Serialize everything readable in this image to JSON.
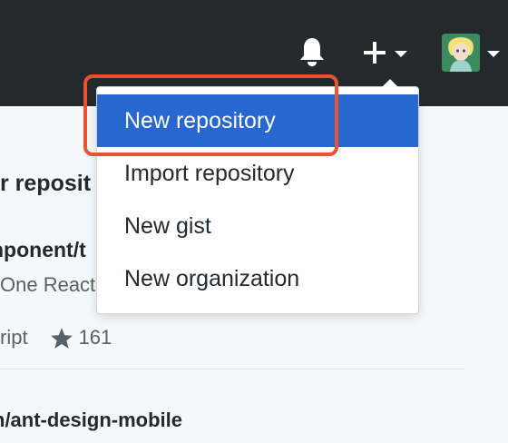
{
  "header": {
    "notification_icon": "bell-icon",
    "create_icon": "plus-icon",
    "avatar_icon": "user-avatar"
  },
  "content": {
    "heading_fragment": "r reposit",
    "repos": [
      {
        "name_fragment": "nponent/t",
        "desc_fragment": "One React",
        "lang_fragment": "ript",
        "stars": "161"
      },
      {
        "name_fragment": "n/ant-design-mobile"
      }
    ]
  },
  "dropdown": {
    "items": [
      {
        "label": "New repository"
      },
      {
        "label": "Import repository"
      },
      {
        "label": "New gist"
      },
      {
        "label": "New organization"
      }
    ]
  },
  "colors": {
    "header_bg": "#24292e",
    "active_item": "#2866d0",
    "highlight_border": "#e8542f"
  }
}
